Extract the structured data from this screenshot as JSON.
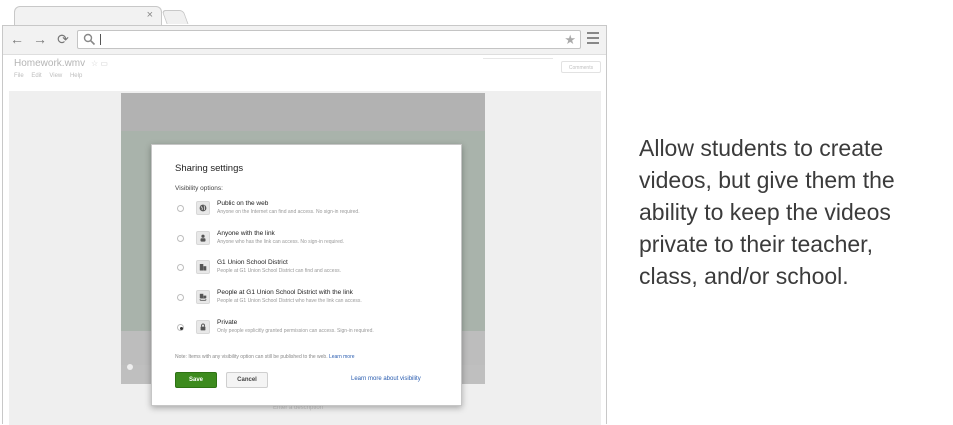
{
  "browser": {
    "tab_close": "×",
    "nav": {
      "back": "←",
      "forward": "→",
      "reload": "⟳"
    },
    "bookmark_star": "★",
    "icons": [
      "search-icon",
      "star-icon",
      "menu-icon",
      "close-icon"
    ]
  },
  "doc": {
    "title": "Homework.wmv",
    "title_icons": "☆ ▭",
    "menu": [
      "File",
      "Edit",
      "View",
      "Help"
    ],
    "comments_label": "Comments",
    "description_placeholder": "Enter a description"
  },
  "dialog": {
    "title": "Sharing settings",
    "subtitle": "Visibility options:",
    "options": [
      {
        "title": "Public on the web",
        "desc": "Anyone on the Internet can find and access. No sign-in required.",
        "icon": "globe-icon",
        "selected": false
      },
      {
        "title": "Anyone with the link",
        "desc": "Anyone who has the link can access. No sign-in required.",
        "icon": "person-icon",
        "selected": false
      },
      {
        "title": "G1 Union School District",
        "desc": "People at G1 Union School District can find and access.",
        "icon": "building-icon",
        "selected": false
      },
      {
        "title": "People at G1 Union School District with the link",
        "desc": "People at G1 Union School District who have the link can access.",
        "icon": "building-link-icon",
        "selected": false
      },
      {
        "title": "Private",
        "desc": "Only people explicitly granted permission can access. Sign-in required.",
        "icon": "lock-icon",
        "selected": true
      }
    ],
    "note_text": "Note: Items with any visibility option can still be published to the web.",
    "note_link": "Learn more",
    "save_label": "Save",
    "cancel_label": "Cancel",
    "learn_more_visibility": "Learn more about visibility",
    "colors": {
      "save": "#3d8b1e",
      "link": "#2a5db0"
    }
  },
  "caption": {
    "line1": "Allow students to create",
    "line2": "videos, but give them the",
    "line3": "ability to keep the videos",
    "line4": "private to their teacher,",
    "line5": "class, and/or school."
  }
}
